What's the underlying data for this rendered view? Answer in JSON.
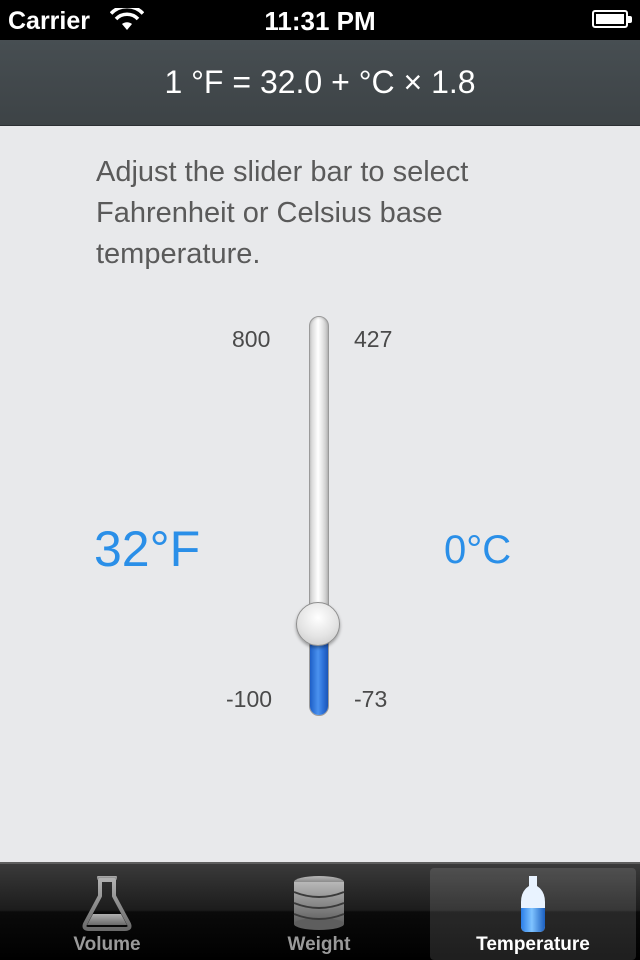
{
  "status_bar": {
    "carrier": "Carrier",
    "time": "11:31 PM",
    "wifi_icon": "wifi-icon",
    "battery_icon": "battery-icon"
  },
  "formula": "1 °F = 32.0 +  °C × 1.8",
  "instructions": "Adjust the slider bar to select Fahrenheit or Celsius base temperature.",
  "slider": {
    "fahrenheit_max": "800",
    "celsius_max": "427",
    "fahrenheit_min": "-100",
    "celsius_min": "-73",
    "value_fraction": 0.146,
    "fill_color": "#2f74db"
  },
  "readout": {
    "fahrenheit": "32°F",
    "celsius": "0°C",
    "color": "#2a8fe8"
  },
  "tabs": [
    {
      "label": "Volume",
      "icon": "flask-icon",
      "selected": false
    },
    {
      "label": "Weight",
      "icon": "coin-stack-icon",
      "selected": false
    },
    {
      "label": "Temperature",
      "icon": "thermometer-icon",
      "selected": true
    }
  ]
}
